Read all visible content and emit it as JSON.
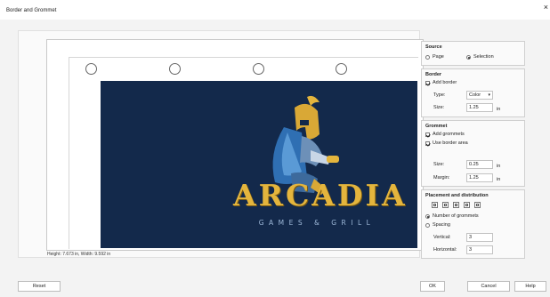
{
  "window": {
    "title": "Border and Grommet",
    "close_glyph": "×"
  },
  "preview": {
    "status": "Height: 7.673 in, Width: 9.592 in",
    "logo_title": "ARCADIA",
    "logo_subtitle": "GAMES & GRILL"
  },
  "source": {
    "title": "Source",
    "page_label": "Page",
    "selection_label": "Selection",
    "selected": "selection"
  },
  "border": {
    "title": "Border",
    "add_border_label": "Add border",
    "add_border_checked": true,
    "type_label": "Type:",
    "type_value": "Color",
    "size_label": "Size:",
    "size_value": "1.25",
    "size_unit": "in"
  },
  "grommet": {
    "title": "Grommet",
    "add_grommets_label": "Add grommets",
    "add_grommets_checked": true,
    "use_border_area_label": "Use border area",
    "use_border_area_checked": true,
    "size_label": "Size:",
    "size_value": "0.25",
    "size_unit": "in",
    "margin_label": "Margin:",
    "margin_value": "1.25",
    "margin_unit": "in"
  },
  "placement": {
    "title": "Placement and distribution",
    "number_label": "Number of grommets",
    "spacing_label": "Spacing",
    "selected": "number",
    "vertical_label": "Vertical:",
    "vertical_value": "3",
    "horizontal_label": "Horizontal:",
    "horizontal_value": "3"
  },
  "buttons": {
    "reset": "Reset",
    "ok": "OK",
    "cancel": "Cancel",
    "help": "Help"
  }
}
